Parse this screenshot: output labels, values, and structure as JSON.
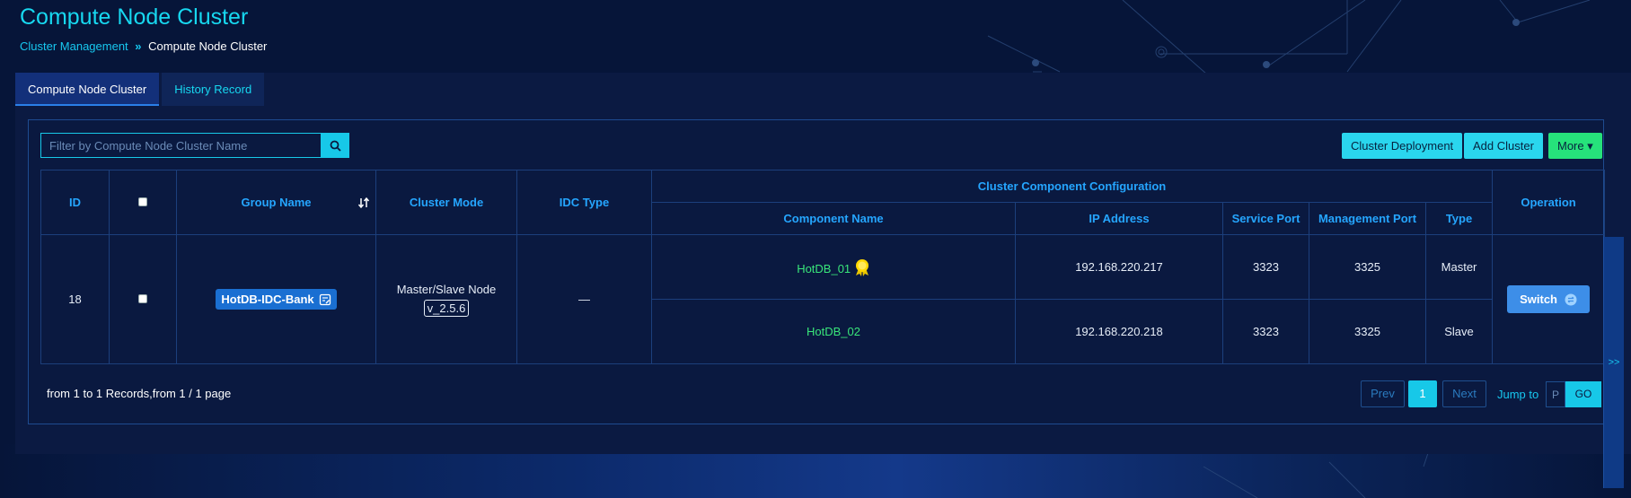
{
  "page": {
    "title": "Compute Node Cluster",
    "breadcrumb": {
      "parent": "Cluster Management",
      "separator": "»",
      "current": "Compute Node Cluster"
    }
  },
  "tabs": [
    {
      "label": "Compute Node Cluster",
      "active": true
    },
    {
      "label": "History Record",
      "active": false
    }
  ],
  "toolbar": {
    "search_placeholder": "Filter by Compute Node Cluster Name",
    "search_value": "",
    "deploy_label": "Cluster Deployment",
    "add_label": "Add Cluster",
    "more_label": "More ▾"
  },
  "table": {
    "headers": {
      "id": "ID",
      "group_name": "Group Name",
      "cluster_mode": "Cluster Mode",
      "idc_type": "IDC Type",
      "component_config": "Cluster Component Configuration",
      "component_name": "Component Name",
      "ip_address": "IP Address",
      "service_port": "Service Port",
      "management_port": "Management Port",
      "type": "Type",
      "operation": "Operation"
    },
    "row": {
      "id": "18",
      "group_name": "HotDB-IDC-Bank",
      "cluster_mode": "Master/Slave Node",
      "version": "v_2.5.6",
      "idc_type": "—",
      "operation": "Switch",
      "components": [
        {
          "name": "HotDB_01",
          "ip": "192.168.220.217",
          "service_port": "3323",
          "management_port": "3325",
          "type": "Master",
          "badge": "master-badge-icon"
        },
        {
          "name": "HotDB_02",
          "ip": "192.168.220.218",
          "service_port": "3323",
          "management_port": "3325",
          "type": "Slave"
        }
      ]
    }
  },
  "pagination": {
    "info": "from 1 to 1 Records,from 1 / 1 page",
    "prev": "Prev",
    "current": "1",
    "next": "Next",
    "jump_label": "Jump to",
    "jump_placeholder": "P",
    "go": "GO"
  },
  "side_toggle": ">>",
  "colors": {
    "background": "#061539",
    "accent": "#17d8f0",
    "header_text": "#25a6ff",
    "component_text": "#39e67a",
    "button_green": "#26e27b",
    "button_blue": "#3d8ee8"
  }
}
